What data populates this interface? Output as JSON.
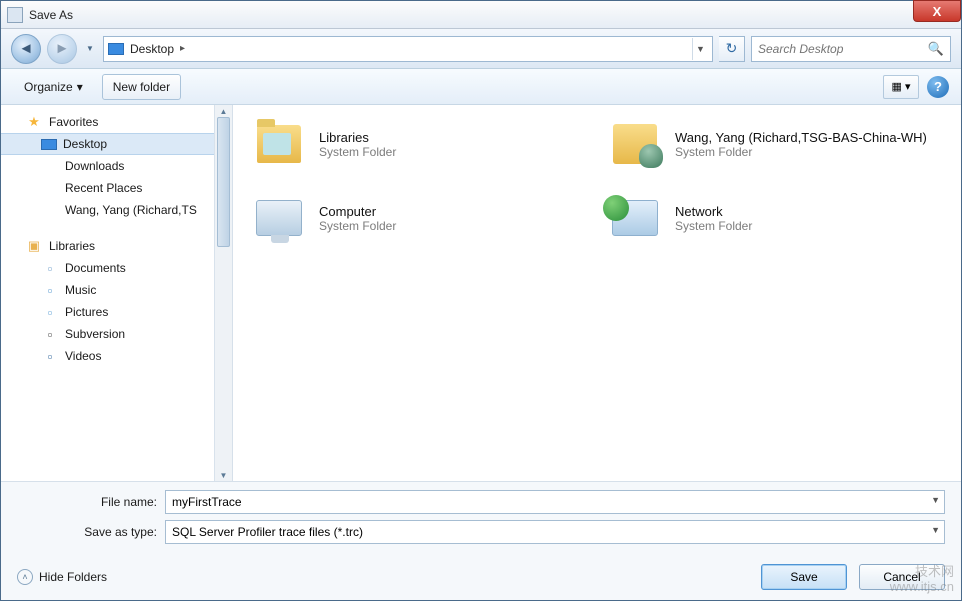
{
  "window": {
    "title": "Save As",
    "close_glyph": "X"
  },
  "nav": {
    "location_label": "Desktop",
    "chevron": "▸",
    "search_placeholder": "Search Desktop"
  },
  "toolbar": {
    "organize": "Organize",
    "dd_glyph": "▾",
    "new_folder": "New folder",
    "help_glyph": "?"
  },
  "sidebar": {
    "favorites": {
      "label": "Favorites",
      "items": [
        {
          "label": "Desktop",
          "icon": "desk",
          "selected": true
        },
        {
          "label": "Downloads",
          "icon": "dl",
          "selected": false
        },
        {
          "label": "Recent Places",
          "icon": "recent",
          "selected": false
        },
        {
          "label": "Wang, Yang (Richard,TS",
          "icon": "user",
          "selected": false
        }
      ]
    },
    "libraries": {
      "label": "Libraries",
      "items": [
        {
          "label": "Documents",
          "icon": "doc"
        },
        {
          "label": "Music",
          "icon": "music"
        },
        {
          "label": "Pictures",
          "icon": "pic"
        },
        {
          "label": "Subversion",
          "icon": "svn"
        },
        {
          "label": "Videos",
          "icon": "vid"
        }
      ]
    }
  },
  "content": {
    "items": [
      {
        "name": "Libraries",
        "type": "System Folder",
        "icon": "lib"
      },
      {
        "name": "Wang, Yang (Richard,TSG-BAS-China-WH)",
        "type": "System Folder",
        "icon": "user"
      },
      {
        "name": "Computer",
        "type": "System Folder",
        "icon": "comp"
      },
      {
        "name": "Network",
        "type": "System Folder",
        "icon": "net"
      }
    ]
  },
  "form": {
    "filename_label": "File name:",
    "filename_value": "myFirstTrace",
    "savetype_label": "Save as type:",
    "savetype_value": "SQL Server Profiler trace files (*.trc)"
  },
  "footer": {
    "hide_folders": "Hide Folders",
    "save": "Save",
    "cancel": "Cancel"
  },
  "watermark": {
    "line1": "技术网",
    "line2": "www.itjs.cn"
  }
}
